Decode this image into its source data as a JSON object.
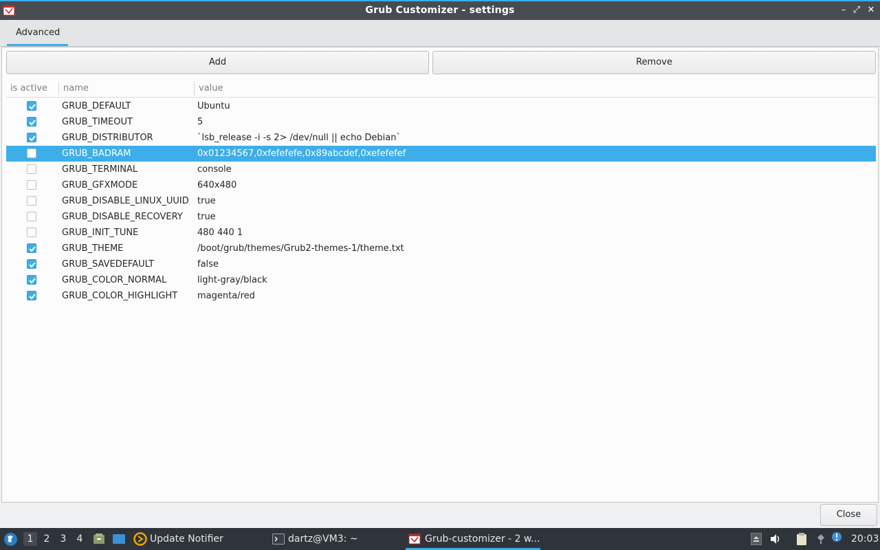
{
  "window": {
    "title": "Grub Customizer - settings",
    "icon": "grub-customizer-icon",
    "controls": {
      "minimize": "–",
      "maximize": "⤢",
      "close": "✕"
    }
  },
  "tabs": [
    {
      "label": "Advanced",
      "active": true
    }
  ],
  "toolbar": {
    "add_label": "Add",
    "remove_label": "Remove"
  },
  "table": {
    "columns": [
      "is active",
      "name",
      "value"
    ],
    "rows": [
      {
        "active": true,
        "name": "GRUB_DEFAULT",
        "value": "Ubuntu",
        "selected": false
      },
      {
        "active": true,
        "name": "GRUB_TIMEOUT",
        "value": "5",
        "selected": false
      },
      {
        "active": true,
        "name": "GRUB_DISTRIBUTOR",
        "value": "`lsb_release -i -s 2> /dev/null || echo Debian`",
        "selected": false
      },
      {
        "active": false,
        "name": "GRUB_BADRAM",
        "value": "0x01234567,0xfefefefe,0x89abcdef,0xefefefef",
        "selected": true
      },
      {
        "active": false,
        "name": "GRUB_TERMINAL",
        "value": "console",
        "selected": false
      },
      {
        "active": false,
        "name": "GRUB_GFXMODE",
        "value": "640x480",
        "selected": false
      },
      {
        "active": false,
        "name": "GRUB_DISABLE_LINUX_UUID",
        "value": "true",
        "selected": false
      },
      {
        "active": false,
        "name": "GRUB_DISABLE_RECOVERY",
        "value": "true",
        "selected": false
      },
      {
        "active": false,
        "name": "GRUB_INIT_TUNE",
        "value": "480 440 1",
        "selected": false
      },
      {
        "active": true,
        "name": "GRUB_THEME",
        "value": "/boot/grub/themes/Grub2-themes-1/theme.txt",
        "selected": false
      },
      {
        "active": true,
        "name": "GRUB_SAVEDEFAULT",
        "value": "false",
        "selected": false
      },
      {
        "active": true,
        "name": "GRUB_COLOR_NORMAL",
        "value": "light-gray/black",
        "selected": false
      },
      {
        "active": true,
        "name": "GRUB_COLOR_HIGHLIGHT",
        "value": "magenta/red",
        "selected": false
      }
    ]
  },
  "footer": {
    "close_label": "Close"
  },
  "taskbar": {
    "desktops": [
      "1",
      "2",
      "3",
      "4"
    ],
    "active_desktop": "1",
    "tasks": [
      {
        "label": "Update Notifier",
        "icon": "update-notifier-icon"
      },
      {
        "label": "dartz@VM3: ~",
        "icon": "terminal-icon"
      },
      {
        "label": "Grub-customizer - 2 w...",
        "icon": "grub-customizer-icon",
        "active": true
      }
    ],
    "clock": "20:03"
  },
  "colors": {
    "accent": "#3daee9",
    "titlebar": "#474c52",
    "taskbar": "#2f343a"
  }
}
